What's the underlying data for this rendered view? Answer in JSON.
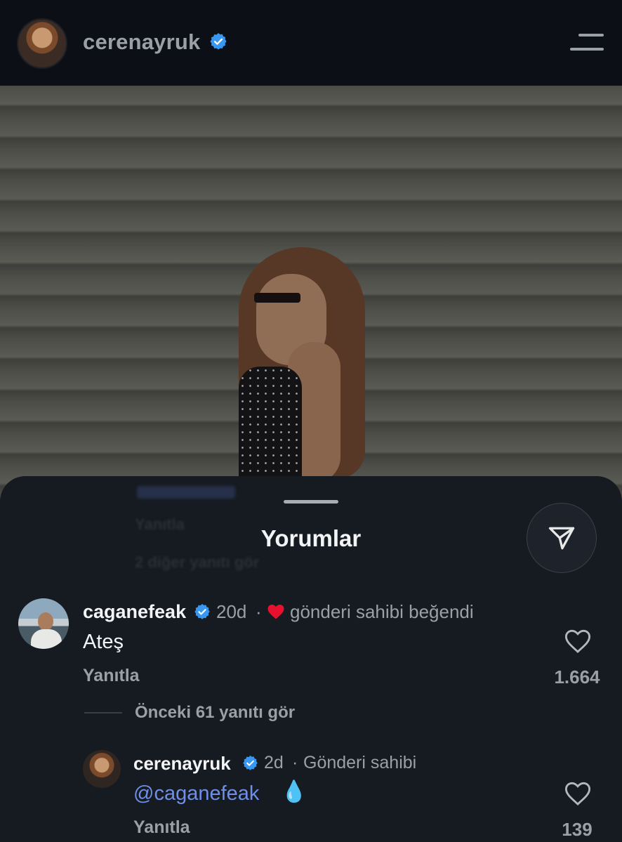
{
  "header": {
    "username": "cerenayruk",
    "verified_icon": "verified-badge-icon",
    "menu_icon": "hamburger-menu-icon"
  },
  "sheet": {
    "title": "Yorumlar",
    "share_icon": "send-icon",
    "ghost_reply": "Yanıtla",
    "ghost_more": "2 diğer yanıtı gör"
  },
  "comments": [
    {
      "username": "caganefeak",
      "time": "20d",
      "separator": "·",
      "meta": "gönderi sahibi beğendi",
      "text": "Ateş",
      "reply_label": "Yanıtla",
      "likes": "1.664",
      "view_previous": "Önceki 61 yanıtı gör"
    },
    {
      "username": "cerenayruk",
      "time": "2d",
      "separator": "·",
      "meta": "Gönderi sahibi",
      "mention": "@caganefeak",
      "emoji": "💧",
      "reply_label": "Yanıtla",
      "likes": "139"
    }
  ],
  "colors": {
    "accent_blue": "#3897f0",
    "mention_blue": "#6f8fe8",
    "heart_red": "#e8112d"
  }
}
